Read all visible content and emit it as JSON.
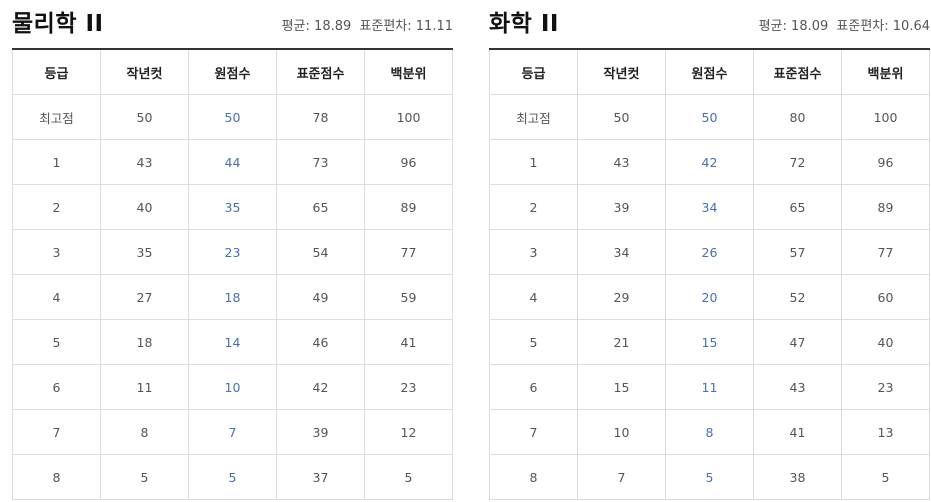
{
  "columns": [
    "등급",
    "작년컷",
    "원점수",
    "표준점수",
    "백분위"
  ],
  "subjects": [
    {
      "title": "물리학 II",
      "mean_label": "평균:",
      "mean": "18.89",
      "sd_label": "표준편차:",
      "sd": "11.11",
      "rows": [
        {
          "grade": "최고점",
          "last_cut": "50",
          "raw": "50",
          "std": "78",
          "pct": "100"
        },
        {
          "grade": "1",
          "last_cut": "43",
          "raw": "44",
          "std": "73",
          "pct": "96"
        },
        {
          "grade": "2",
          "last_cut": "40",
          "raw": "35",
          "std": "65",
          "pct": "89"
        },
        {
          "grade": "3",
          "last_cut": "35",
          "raw": "23",
          "std": "54",
          "pct": "77"
        },
        {
          "grade": "4",
          "last_cut": "27",
          "raw": "18",
          "std": "49",
          "pct": "59"
        },
        {
          "grade": "5",
          "last_cut": "18",
          "raw": "14",
          "std": "46",
          "pct": "41"
        },
        {
          "grade": "6",
          "last_cut": "11",
          "raw": "10",
          "std": "42",
          "pct": "23"
        },
        {
          "grade": "7",
          "last_cut": "8",
          "raw": "7",
          "std": "39",
          "pct": "12"
        },
        {
          "grade": "8",
          "last_cut": "5",
          "raw": "5",
          "std": "37",
          "pct": "5"
        }
      ]
    },
    {
      "title": "화학 II",
      "mean_label": "평균:",
      "mean": "18.09",
      "sd_label": "표준편차:",
      "sd": "10.64",
      "rows": [
        {
          "grade": "최고점",
          "last_cut": "50",
          "raw": "50",
          "std": "80",
          "pct": "100"
        },
        {
          "grade": "1",
          "last_cut": "43",
          "raw": "42",
          "std": "72",
          "pct": "96"
        },
        {
          "grade": "2",
          "last_cut": "39",
          "raw": "34",
          "std": "65",
          "pct": "89"
        },
        {
          "grade": "3",
          "last_cut": "34",
          "raw": "26",
          "std": "57",
          "pct": "77"
        },
        {
          "grade": "4",
          "last_cut": "29",
          "raw": "20",
          "std": "52",
          "pct": "60"
        },
        {
          "grade": "5",
          "last_cut": "21",
          "raw": "15",
          "std": "47",
          "pct": "40"
        },
        {
          "grade": "6",
          "last_cut": "15",
          "raw": "11",
          "std": "43",
          "pct": "23"
        },
        {
          "grade": "7",
          "last_cut": "10",
          "raw": "8",
          "std": "41",
          "pct": "13"
        },
        {
          "grade": "8",
          "last_cut": "7",
          "raw": "5",
          "std": "38",
          "pct": "5"
        }
      ]
    }
  ]
}
